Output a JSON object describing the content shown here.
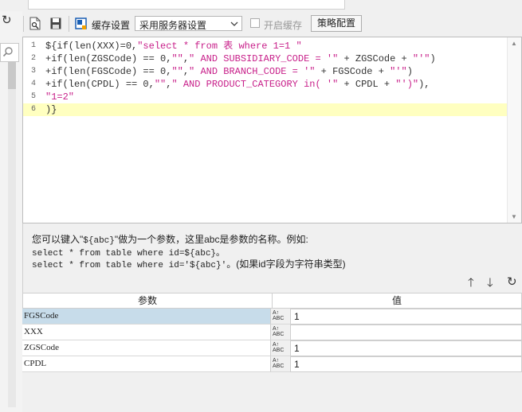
{
  "toolbar": {
    "cache_settings_label": "缓存设置",
    "cache_mode_value": "采用服务器设置",
    "enable_cache_label": "开启缓存",
    "strategy_button": "策略配置"
  },
  "editor": {
    "lines": [
      {
        "num": "1",
        "segments": [
          [
            "var",
            "${if(len(XXX)=0,"
          ],
          [
            "str",
            "\"select * from 表 where 1=1 \""
          ]
        ]
      },
      {
        "num": "2",
        "segments": [
          [
            "var",
            "+if(len(ZGSCode) == 0,"
          ],
          [
            "str",
            "\"\""
          ],
          [
            "var",
            ","
          ],
          [
            "str",
            "\" AND SUBSIDIARY_CODE = '\""
          ],
          [
            "var",
            " + ZGSCode + "
          ],
          [
            "str",
            "\"'\""
          ],
          [
            "var",
            ")"
          ]
        ]
      },
      {
        "num": "3",
        "segments": [
          [
            "var",
            "+if(len(FGSCode) == 0,"
          ],
          [
            "str",
            "\"\""
          ],
          [
            "var",
            ","
          ],
          [
            "str",
            "\" AND BRANCH_CODE = '\""
          ],
          [
            "var",
            " + FGSCode + "
          ],
          [
            "str",
            "\"'\""
          ],
          [
            "var",
            ")"
          ]
        ]
      },
      {
        "num": "4",
        "segments": [
          [
            "var",
            "+if(len(CPDL) == 0,"
          ],
          [
            "str",
            "\"\""
          ],
          [
            "var",
            ","
          ],
          [
            "str",
            "\" AND PRODUCT_CATEGORY in( '\""
          ],
          [
            "var",
            " + CPDL + "
          ],
          [
            "str",
            "\"')\""
          ],
          [
            "var",
            "),"
          ]
        ]
      },
      {
        "num": "5",
        "segments": [
          [
            "str",
            "\"1=2\""
          ]
        ]
      },
      {
        "num": "6",
        "segments": [
          [
            "var",
            ")}"
          ]
        ]
      }
    ]
  },
  "help": {
    "line1_prefix": "您可以键入\"",
    "line1_token": "${abc}",
    "line1_suffix": "\"做为一个参数，这里abc是参数的名称。例如:",
    "line2": "select * from table where id=${abc}。",
    "line3_code": "select * from table where id='${abc}'",
    "line3_note": "。(如果id字段为字符串类型)"
  },
  "params": {
    "header_name": "参数",
    "header_value": "值",
    "type_glyph": "ABC",
    "rows": [
      {
        "name": "FGSCode",
        "value": "1"
      },
      {
        "name": "XXX",
        "value": ""
      },
      {
        "name": "ZGSCode",
        "value": "1"
      },
      {
        "name": "CPDL",
        "value": "1"
      }
    ]
  }
}
